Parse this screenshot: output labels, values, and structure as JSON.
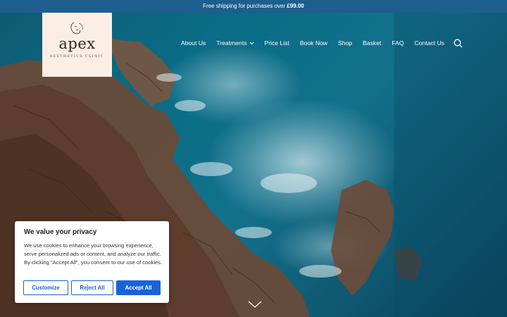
{
  "announcement": {
    "text": "Free shipping for purchases over ",
    "amount": "£99.00"
  },
  "logo": {
    "wordmark": "apex",
    "tagline": "AESTHETICS CLINIC"
  },
  "nav": {
    "items": [
      {
        "label": "About Us"
      },
      {
        "label": "Treatments"
      },
      {
        "label": "Price List"
      },
      {
        "label": "Book Now"
      },
      {
        "label": "Shop"
      },
      {
        "label": "Basket"
      },
      {
        "label": "FAQ"
      },
      {
        "label": "Contact Us"
      }
    ],
    "search_icon": "search-icon",
    "treatments_dropdown_icon": "chevron-down-icon"
  },
  "hero": {
    "scroll_icon": "chevron-down-icon"
  },
  "cookie": {
    "title": "We value your privacy",
    "body": "We use cookies to enhance your browsing experience, serve personalized ads or content, and analyze our traffic. By clicking \"Accept All\", you consent to our use of cookies.",
    "customize_label": "Customize",
    "reject_label": "Reject All",
    "accept_label": "Accept All"
  },
  "colors": {
    "announcement_bg": "#1d5e8e",
    "logo_bg": "#fbeee4",
    "accent": "#1863dc"
  }
}
